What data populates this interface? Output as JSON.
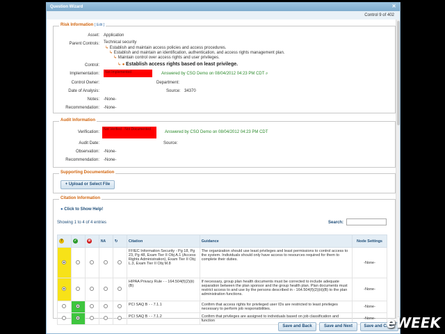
{
  "window": {
    "title": "Question Wizard",
    "counter": "Control 9 of 402"
  },
  "risk": {
    "legend": "Risk Information",
    "edit": "[ Edit ]",
    "asset_label": "Asset:",
    "asset": "Application",
    "parent_label": "Parent Controls:",
    "parents": [
      "Technical security",
      "Establish and maintain access policies and access procedures.",
      "Establish and maintain an identification, authentication, and access rights management plan.",
      "Maintain control over access rights and user privileges."
    ],
    "control_label": "Control:",
    "control": "Establish access rights based on least privilege.",
    "implementation_label": "Implementation:",
    "implementation_value": "Not Implemented",
    "implementation_answer": "Answered by CSO Demo on 08/04/2012 04:23 PM CDT",
    "owner_label": "Control Owner:",
    "department_label": "Department:",
    "analysis_label": "Date of Analysis:",
    "source_label": "Source:",
    "source": "34370",
    "notes_label": "Notes:",
    "notes": "-None-",
    "recommendation_label": "Recommendation:",
    "recommendation": "-None-"
  },
  "audit": {
    "legend": "Audit Information",
    "verification_label": "Verification:",
    "verification_value": "Not Verified - Not Documented",
    "verification_answer": "Answered by CSO Demo on 08/04/2012 04:23 PM CDT",
    "date_label": "Audit Date:",
    "source_label": "Source:",
    "observation_label": "Observation:",
    "observation": "-None-",
    "recommendation_label": "Recommendation:",
    "recommendation": "-None-"
  },
  "docs": {
    "legend": "Supporting Documentation",
    "upload": "+ Upload or Select File"
  },
  "citation": {
    "legend": "Citation Information",
    "help": "Click to Show Help!",
    "showing": "Showing 1 to 4 of 4 entries",
    "search_label": "Search:",
    "headers": {
      "citation": "Citation",
      "guidance": "Guidance",
      "node": "Node Settings"
    },
    "rows": [
      {
        "citation": "FFIEC Information Security - Pg 18, Pg 23, Pg 48, Exam Tier II Obj A.1 (Access Rights Administration), Exam Tier II Obj L.3, Exam Tier II Obj M.8",
        "guidance": "The organization should use least privileges and least permissions to control access to the system. Individuals should only have access to resources required for them to complete their duties.",
        "node": "-None-",
        "color": "yellow",
        "selected": 0
      },
      {
        "citation": "HIPAA Privacy Rule - - 164.504(f)(2)(ii)(B)",
        "guidance": "If necessary, group plan health documents must be corrected to include adequate separation between the plan sponsor and the group health plan. Plan documents must restrict access to and use by the persons described in - 164.504(f)(2)(iii)(B) to the plan administration functions.",
        "node": "-None-",
        "color": "yellow",
        "selected": 0
      },
      {
        "citation": "PCI SAQ B - - 7.1.1",
        "guidance": "Confirm that access rights for privileged user IDs are restricted to least privileges necessary to perform job responsibilities.",
        "node": "-None-",
        "color": "green",
        "selected": 1
      },
      {
        "citation": "PCI SAQ B - - 7.1.2",
        "guidance": "Confirm that privileges are assigned to individuals based on job classification and function",
        "node": "-None-",
        "color": "green",
        "selected": 1
      }
    ]
  },
  "buttons": {
    "save_back": "Save and Back",
    "save_next": "Save and Next",
    "save_close": "Save and Close"
  },
  "watermark": "eWEEK"
}
